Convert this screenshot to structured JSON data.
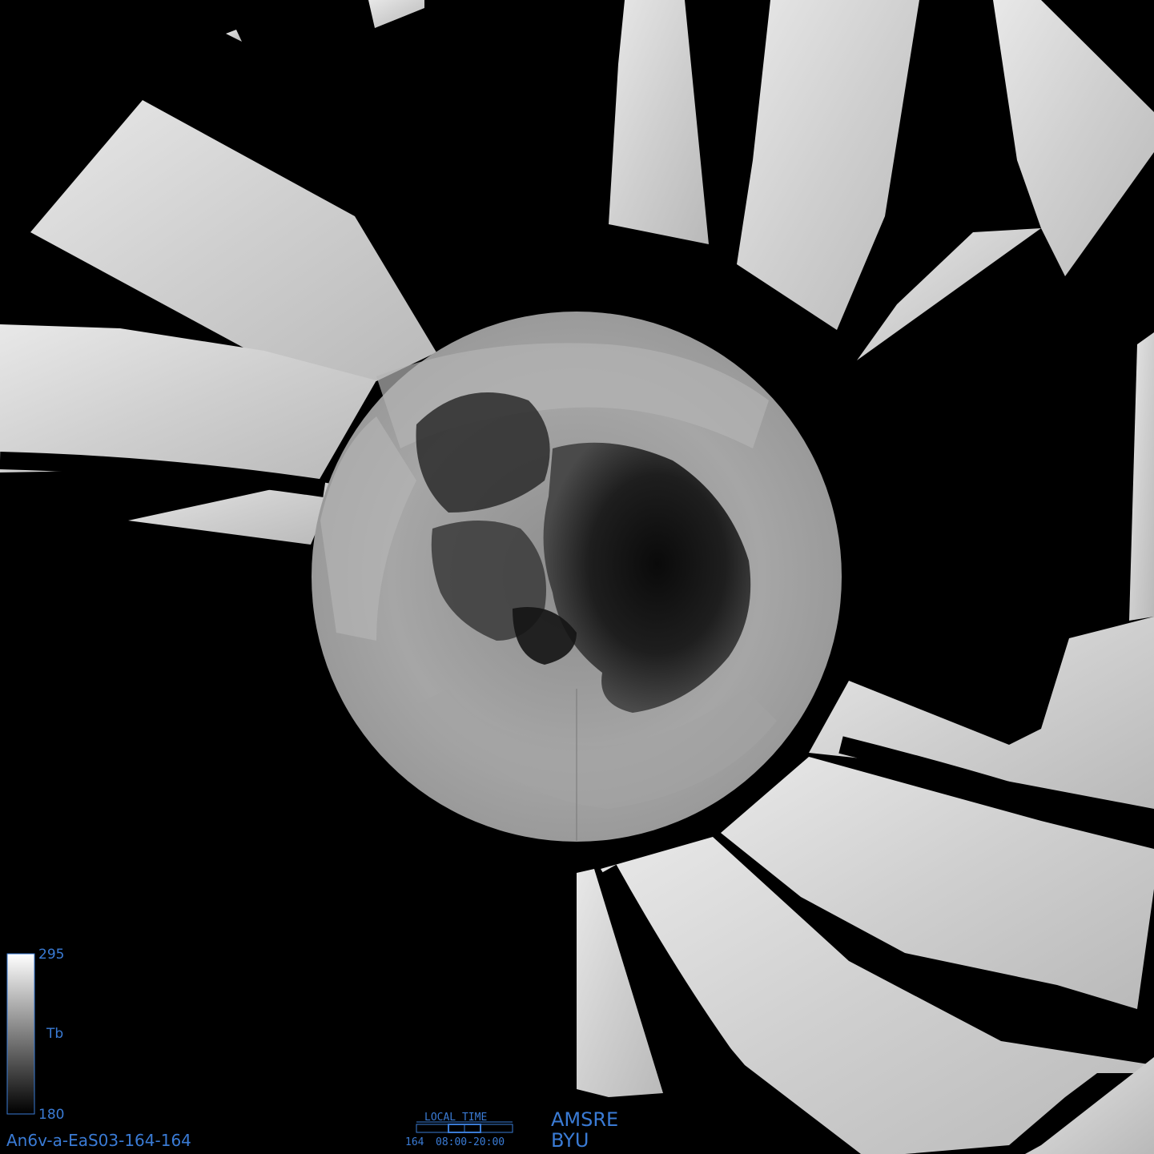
{
  "legend": {
    "max_label": "295",
    "min_label": "180",
    "unit_label": "Tb",
    "color_low": "#000000",
    "color_high": "#ffffff",
    "accent": "#3a7bd5"
  },
  "image_id_label": "An6v-a-EaS03-164-164",
  "time_box": {
    "title": "LOCAL TIME",
    "day_label": "164",
    "range_label": "08:00-20:00"
  },
  "instrument": {
    "sensor": "AMSRE",
    "institution": "BYU"
  }
}
